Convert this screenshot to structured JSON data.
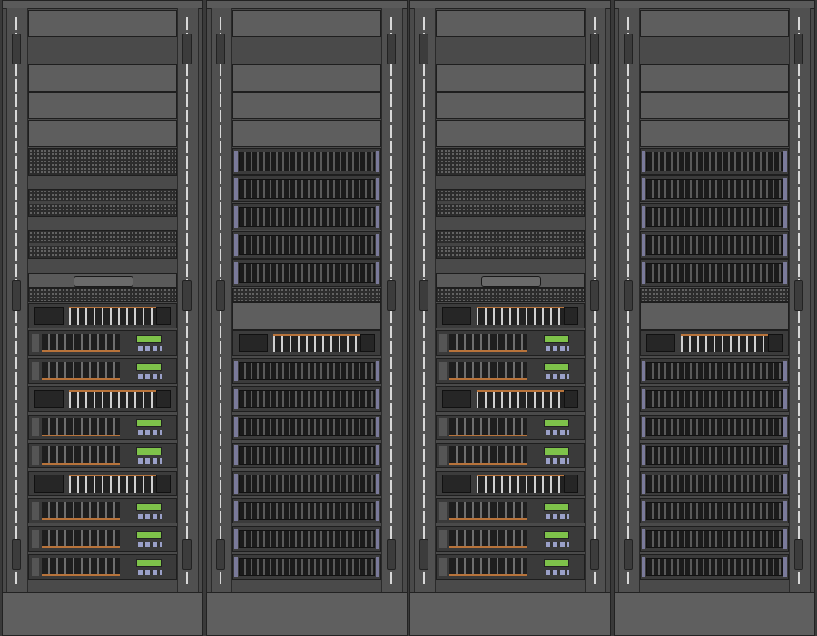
{
  "rack_a": {
    "units": [
      {
        "kind": "blank"
      },
      {
        "kind": "blank"
      },
      {
        "kind": "blank"
      },
      {
        "kind": "blank"
      },
      {
        "kind": "perf"
      },
      {
        "kind": "perf-pair"
      },
      {
        "kind": "perf-pair"
      },
      {
        "kind": "handle"
      },
      {
        "kind": "perf"
      },
      {
        "kind": "io"
      },
      {
        "kind": "server"
      },
      {
        "kind": "server"
      },
      {
        "kind": "io"
      },
      {
        "kind": "server"
      },
      {
        "kind": "server"
      },
      {
        "kind": "io"
      },
      {
        "kind": "server"
      },
      {
        "kind": "server"
      },
      {
        "kind": "server"
      }
    ]
  },
  "rack_b": {
    "units": [
      {
        "kind": "blank"
      },
      {
        "kind": "blank"
      },
      {
        "kind": "blank"
      },
      {
        "kind": "blank"
      },
      {
        "kind": "storage"
      },
      {
        "kind": "storage"
      },
      {
        "kind": "storage"
      },
      {
        "kind": "storage"
      },
      {
        "kind": "storage"
      },
      {
        "kind": "perf"
      },
      {
        "kind": "blank"
      },
      {
        "kind": "io"
      },
      {
        "kind": "storage"
      },
      {
        "kind": "storage"
      },
      {
        "kind": "storage"
      },
      {
        "kind": "storage"
      },
      {
        "kind": "storage"
      },
      {
        "kind": "storage"
      },
      {
        "kind": "storage"
      },
      {
        "kind": "storage"
      }
    ]
  }
}
